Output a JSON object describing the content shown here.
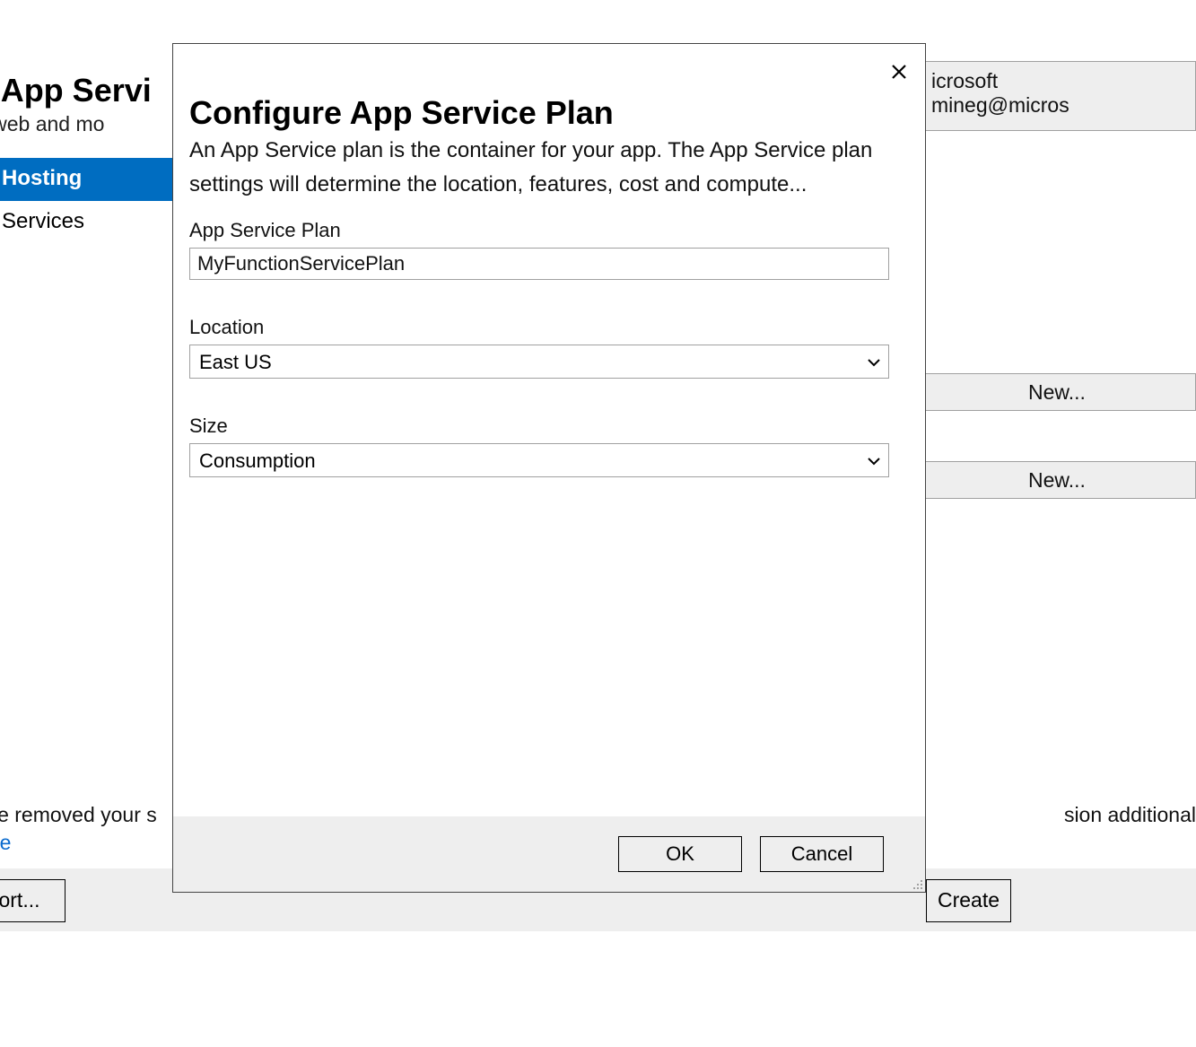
{
  "background": {
    "title_fragment": "ate App Servi",
    "subtitle_fragment": "your web and mo",
    "identity_line1": "icrosoft",
    "identity_line2": "mineg@micros",
    "sidebar": {
      "items": [
        {
          "label": "Hosting",
          "active": true
        },
        {
          "label": "Services",
          "active": false
        }
      ]
    },
    "new_button_label": "New...",
    "removed_text_fragment": "have removed your s",
    "additional_text_fragment": "sion additional",
    "more_link_label": "More",
    "bottom_ort_label": "ort...",
    "bottom_create_label": "Create"
  },
  "modal": {
    "title": "Configure App Service Plan",
    "description": "An App Service plan is the container for your app. The App Service plan settings will determine the location, features, cost and compute...",
    "fields": {
      "plan": {
        "label": "App Service Plan",
        "value": "MyFunctionServicePlan"
      },
      "location": {
        "label": "Location",
        "value": "East US",
        "options": [
          "East US"
        ]
      },
      "size": {
        "label": "Size",
        "value": "Consumption",
        "options": [
          "Consumption"
        ]
      }
    },
    "buttons": {
      "ok": "OK",
      "cancel": "Cancel"
    }
  }
}
